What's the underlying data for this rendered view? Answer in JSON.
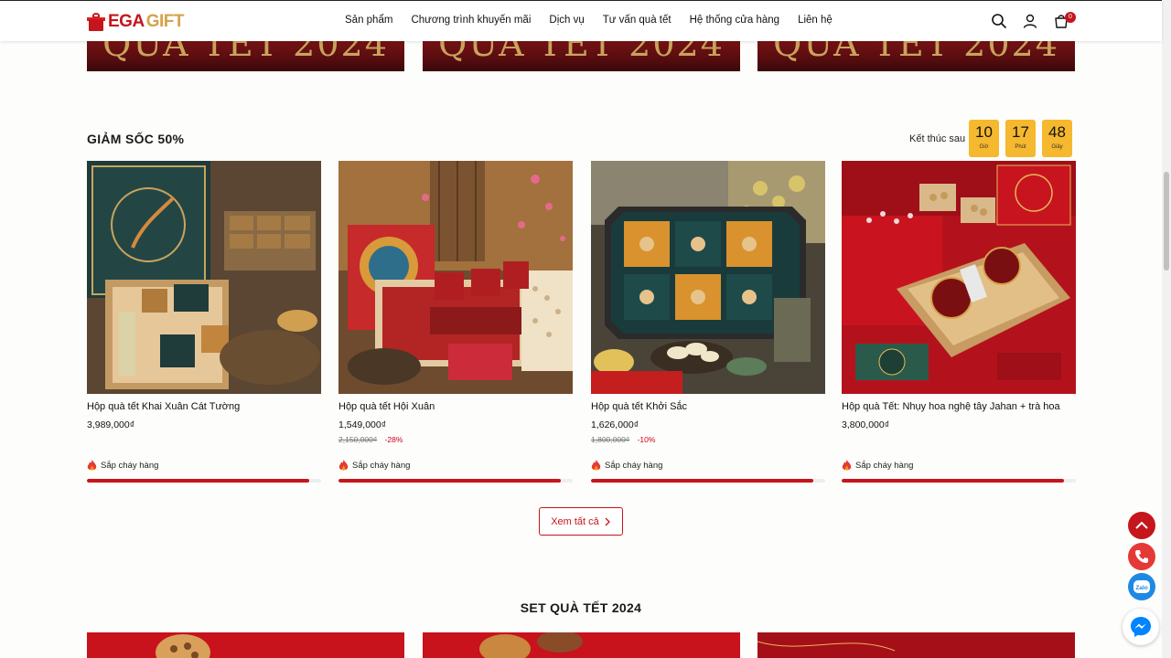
{
  "banners": [
    "QUÀ TẾT 2024",
    "QUÀ TẾT 2024",
    "QUÀ TẾT 2024"
  ],
  "header": {
    "logo_ega": "EGA",
    "logo_gift": "GIFT",
    "nav": [
      "Sản phẩm",
      "Chương trình khuyến mãi",
      "Dịch vụ",
      "Tư vấn quà tết",
      "Hệ thống cửa hàng",
      "Liên hệ"
    ],
    "cart_count": "0"
  },
  "flash_sale": {
    "title": "GIẢM SỐC 50%",
    "countdown_label": "Kết thúc sau",
    "countdown": [
      {
        "value": "10",
        "unit": "Giờ"
      },
      {
        "value": "17",
        "unit": "Phút"
      },
      {
        "value": "48",
        "unit": "Giây"
      }
    ],
    "products": [
      {
        "name": "Hộp quà tết Khai Xuân Cát Tường",
        "price": "3,989,000₫",
        "old_price": "",
        "discount": "",
        "stock_label": "Sắp cháy hàng",
        "sold_fraction": 0.95
      },
      {
        "name": "Hộp quà tết Hội Xuân",
        "price": "1,549,000₫",
        "old_price": "2,150,000₫",
        "discount": "-28%",
        "stock_label": "Sắp cháy hàng",
        "sold_fraction": 0.95
      },
      {
        "name": "Hộp quà tết Khởi Sắc",
        "price": "1,626,000₫",
        "old_price": "1,800,000₫",
        "discount": "-10%",
        "stock_label": "Sắp cháy hàng",
        "sold_fraction": 0.95
      },
      {
        "name": "Hộp quà Tết: Nhụy hoa nghệ tây Jahan + trà hoa",
        "price": "3,800,000₫",
        "old_price": "",
        "discount": "",
        "stock_label": "Sắp cháy hàng",
        "sold_fraction": 0.95
      }
    ],
    "see_all": "Xem tất cả"
  },
  "set_section": {
    "title": "SET QUÀ TẾT 2024"
  },
  "colors": {
    "brand_red": "#c4161c",
    "gold": "#d5a24a",
    "countdown_bg": "#f5b82e",
    "messenger": "#0084ff",
    "zalo": "#1e88e5"
  }
}
